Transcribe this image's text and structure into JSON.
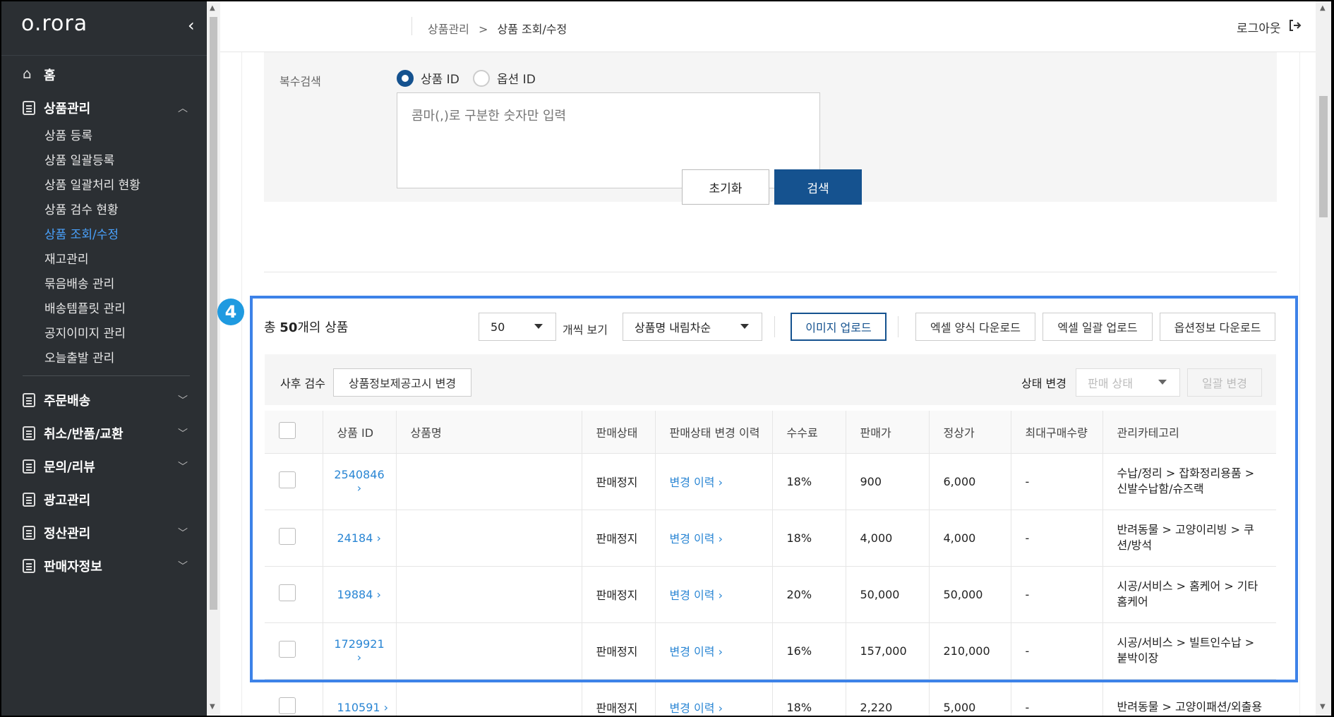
{
  "sidebar": {
    "logo": "o.rora",
    "collapse_icon": "chevron-left-icon",
    "home": "홈",
    "product_mgmt": "상품관리",
    "sub_items": [
      "상품 등록",
      "상품 일괄등록",
      "상품 일괄처리 현황",
      "상품 검수 현황",
      "상품 조회/수정",
      "재고관리",
      "묶음배송 관리",
      "배송템플릿 관리",
      "공지이미지 관리",
      "오늘출발 관리"
    ],
    "active_sub": "상품 조회/수정",
    "menus": [
      "주문배송",
      "취소/반품/교환",
      "문의/리뷰",
      "광고관리",
      "정산관리",
      "판매자정보"
    ]
  },
  "header": {
    "breadcrumb_parent": "상품관리",
    "breadcrumb_sep": ">",
    "breadcrumb_current": "상품 조회/수정",
    "logout": "로그아웃"
  },
  "search": {
    "label": "복수검색",
    "radio_product_id": "상품 ID",
    "radio_option_id": "옵션 ID",
    "selected": "상품 ID",
    "placeholder": "콤마(,)로 구분한 숫자만 입력",
    "reset_btn": "초기화",
    "search_btn": "검색"
  },
  "marker": "4",
  "results": {
    "total_prefix": "총 ",
    "total_count": "50",
    "total_suffix": "개의 상품",
    "per_page": "50",
    "per_page_label": "개씩 보기",
    "sort": "상품명 내림차순",
    "image_upload": "이미지 업로드",
    "excel_template": "엑셀 양식 다운로드",
    "excel_bulk": "엑셀 일괄 업로드",
    "option_download": "옵션정보 다운로드",
    "post_review": "사후 검수",
    "notice_change": "상품정보제공고시 변경",
    "status_change": "상태 변경",
    "status_placeholder": "판매 상태",
    "bulk_change": "일괄 변경"
  },
  "table": {
    "headers": [
      "상품 ID",
      "상품명",
      "판매상태",
      "판매상태 변경 이력",
      "수수료",
      "판매가",
      "정상가",
      "최대구매수량",
      "관리카테고리"
    ],
    "rows": [
      {
        "id": "2540846",
        "name": "",
        "status": "판매정지",
        "history": "변경 이력",
        "fee": "18%",
        "price": "900",
        "regular": "6,000",
        "max": "-",
        "category": "수납/정리 > 잡화정리용품 > 신발수납함/슈즈랙"
      },
      {
        "id": "24184",
        "name": "",
        "status": "판매정지",
        "history": "변경 이력",
        "fee": "18%",
        "price": "4,000",
        "regular": "4,000",
        "max": "-",
        "category": "반려동물 > 고양이리빙 > 쿠션/방석"
      },
      {
        "id": "19884",
        "name": "",
        "status": "판매정지",
        "history": "변경 이력",
        "fee": "20%",
        "price": "50,000",
        "regular": "50,000",
        "max": "-",
        "category": "시공/서비스 > 홈케어 > 기타홈케어"
      },
      {
        "id": "1729921",
        "name": "",
        "status": "판매정지",
        "history": "변경 이력",
        "fee": "16%",
        "price": "157,000",
        "regular": "210,000",
        "max": "-",
        "category": "시공/서비스 > 빌트인수납 > 붙박이장"
      },
      {
        "id": "110591",
        "name": "",
        "status": "판매정지",
        "history": "변경 이력",
        "fee": "18%",
        "price": "2,220",
        "regular": "5,000",
        "max": "-",
        "category": "반려동물 > 고양이패션/외출용"
      }
    ]
  }
}
